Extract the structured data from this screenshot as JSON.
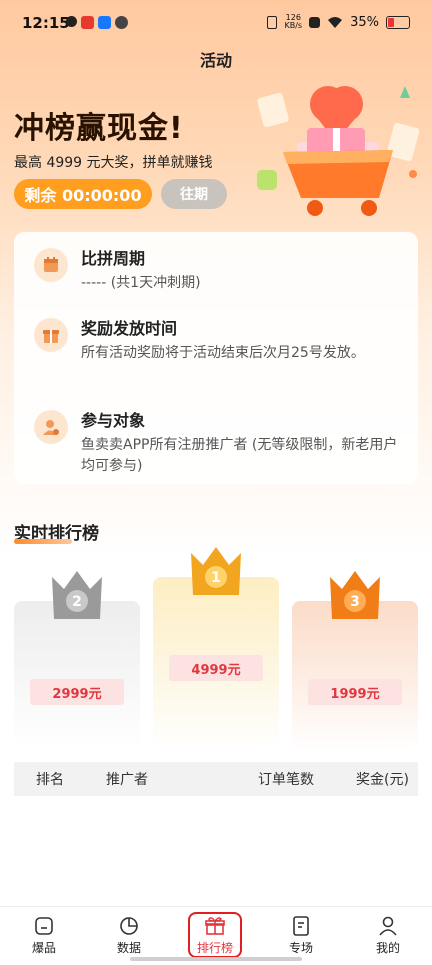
{
  "status_bar": {
    "time": "12:15",
    "speed_value": "126",
    "speed_unit": "KB/s",
    "battery": "35%"
  },
  "page_title": "活动",
  "hero": {
    "headline": "冲榜赢现金!",
    "subline": "最高 4999 元大奖，拼单就赚钱",
    "countdown": "剩余 00:00:00",
    "past_button": "往期"
  },
  "info": [
    {
      "title": "比拼周期",
      "desc": "----- (共1天冲刺期)",
      "icon": "calendar-icon"
    },
    {
      "title": "奖励发放时间",
      "desc": "所有活动奖励将于活动结束后次月25号发放。",
      "icon": "gift-icon"
    },
    {
      "title": "参与对象",
      "desc": "鱼卖卖APP所有注册推广者 (无等级限制，新老用户均可参与)",
      "icon": "user-icon"
    }
  ],
  "ranking": {
    "title": "实时排行榜",
    "podium": [
      {
        "rank": "2",
        "amount": "2999元",
        "color": "#9a9a9a"
      },
      {
        "rank": "1",
        "amount": "4999元",
        "color": "#f2a51e"
      },
      {
        "rank": "3",
        "amount": "1999元",
        "color": "#f07d15"
      }
    ],
    "columns": [
      "排名",
      "推广者",
      "订单笔数",
      "奖金(元)"
    ]
  },
  "tabbar": [
    {
      "label": "爆品",
      "icon": "home-icon"
    },
    {
      "label": "数据",
      "icon": "pie-chart-icon"
    },
    {
      "label": "排行榜",
      "icon": "gift-icon"
    },
    {
      "label": "专场",
      "icon": "document-icon"
    },
    {
      "label": "我的",
      "icon": "person-icon"
    }
  ],
  "colors": {
    "accent": "#ff9e1f",
    "active_tab": "#e0383e",
    "price": "#e0383e"
  }
}
